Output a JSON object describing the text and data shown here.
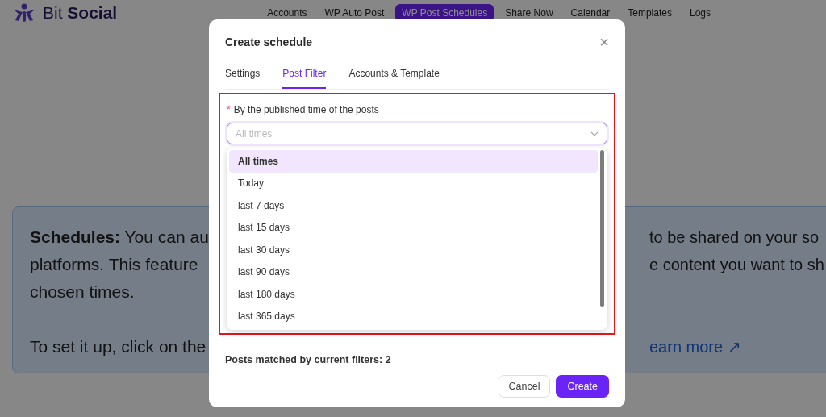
{
  "brand": {
    "name": "Bit **Social**"
  },
  "nav": [
    {
      "label": "Accounts",
      "selected": false
    },
    {
      "label": "WP Auto Post",
      "selected": false
    },
    {
      "label": "WP Post Schedules",
      "selected": true
    },
    {
      "label": "Share Now",
      "selected": false
    },
    {
      "label": "Calendar",
      "selected": false
    },
    {
      "label": "Templates",
      "selected": false
    },
    {
      "label": "Logs",
      "selected": false
    }
  ],
  "info": {
    "left_paragraphs": [
      [
        "**Schedules:** You can au",
        "platforms. This feature",
        "chosen times."
      ],
      [
        "To set it up, click on the"
      ]
    ],
    "right_lines": [
      "to be shared on your so",
      "e content you want to sh"
    ],
    "link": "earn more ↗"
  },
  "dialog": {
    "title": "Create schedule",
    "close": "×",
    "tabs": [
      {
        "label": "Settings",
        "selected": false
      },
      {
        "label": "Post Filter",
        "selected": true
      },
      {
        "label": "Accounts & Template",
        "selected": false
      }
    ],
    "field": {
      "required_mark": "*",
      "label": "By the published time of the posts",
      "placeholder": "All times",
      "expanded": true
    },
    "options": [
      {
        "label": "All times",
        "selected": true
      },
      {
        "label": "Today",
        "selected": false
      },
      {
        "label": "last 7 days",
        "selected": false
      },
      {
        "label": "last 15 days",
        "selected": false
      },
      {
        "label": "last 30 days",
        "selected": false
      },
      {
        "label": "last 90 days",
        "selected": false
      },
      {
        "label": "last 180 days",
        "selected": false
      },
      {
        "label": "last 365 days",
        "selected": false
      }
    ],
    "matched": "Posts matched by current filters: 2",
    "buttons": [
      {
        "label": "Cancel",
        "kind": "secondary"
      },
      {
        "label": "Create",
        "kind": "primary"
      }
    ]
  }
}
